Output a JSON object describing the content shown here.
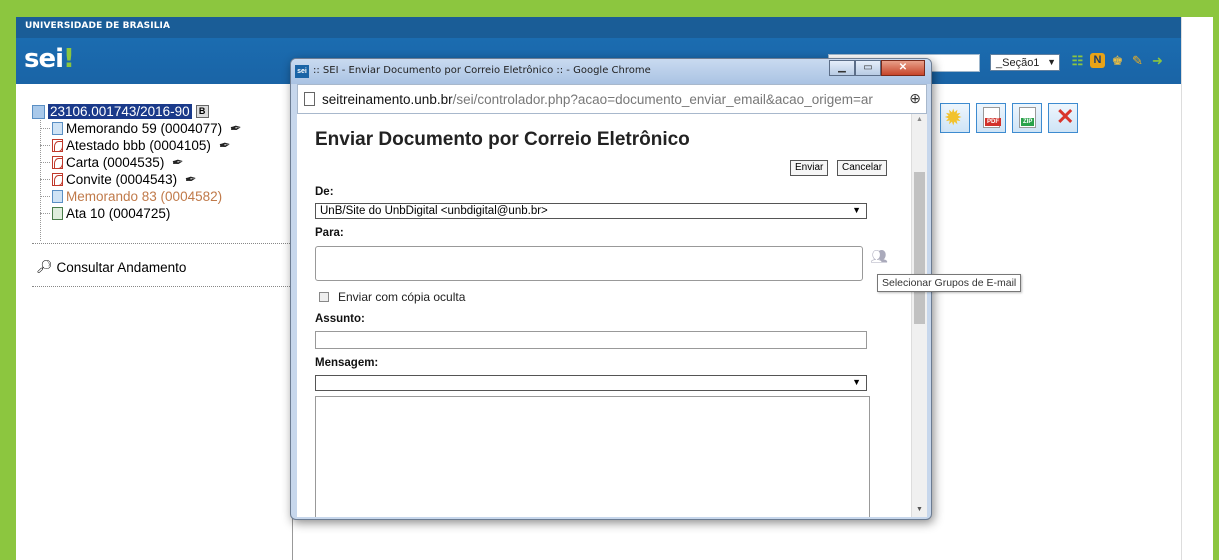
{
  "app": {
    "org_name": "UNIVERSIDADE DE BRASILIA",
    "logo": {
      "text": "sei",
      "accent": "!"
    },
    "unit_select": "_Seção1",
    "header_icons": [
      "list-icon",
      "notes-icon",
      "user-icon",
      "tools-icon",
      "exit-icon"
    ]
  },
  "tree": {
    "process": {
      "number": "23106.001743/2016-90",
      "badge": "B"
    },
    "documents": [
      {
        "label": "Memorando 59 (0004077)",
        "icon": "doc-icon",
        "signed": true,
        "style": "normal"
      },
      {
        "label": "Atestado bbb (0004105)",
        "icon": "pdf-icon",
        "signed": true,
        "style": "normal"
      },
      {
        "label": "Carta (0004535)",
        "icon": "pdf-icon",
        "signed": true,
        "style": "normal"
      },
      {
        "label": "Convite (0004543)",
        "icon": "pdf-icon",
        "signed": true,
        "style": "normal"
      },
      {
        "label": "Memorando 83 (0004582)",
        "icon": "doc-icon",
        "signed": false,
        "style": "orange"
      },
      {
        "label": "Ata 10 (0004725)",
        "icon": "ata-icon",
        "signed": false,
        "style": "normal"
      }
    ],
    "consultar_andamento": "Consultar Andamento"
  },
  "toolbar_right": {
    "pdf_tag": "PDF",
    "zip_tag": "ZIP"
  },
  "popup": {
    "window_title": ":: SEI - Enviar Documento por Correio Eletrônico :: - Google Chrome",
    "favicon": "sei",
    "url_host": "seitreinamento.unb.br",
    "url_path": "/sei/controlador.php?acao=documento_enviar_email&acao_origem=ar",
    "form": {
      "title": "Enviar Documento por Correio Eletrônico",
      "enviar_label": "Enviar",
      "cancelar_label": "Cancelar",
      "de_label": "De:",
      "de_value": "UnB/Site do UnbDigital <unbdigital@unb.br>",
      "para_label": "Para:",
      "bcc_label": "Enviar com cópia oculta",
      "assunto_label": "Assunto:",
      "mensagem_label": "Mensagem:",
      "mensagem_value": ""
    },
    "tooltip": "Selecionar Grupos de E-mail"
  },
  "colors": {
    "frame_green": "#8cc63f",
    "header_blue": "#1a64a6",
    "selected_process": "#1a3a8a",
    "unsigned_doc": "#c07a4a"
  }
}
